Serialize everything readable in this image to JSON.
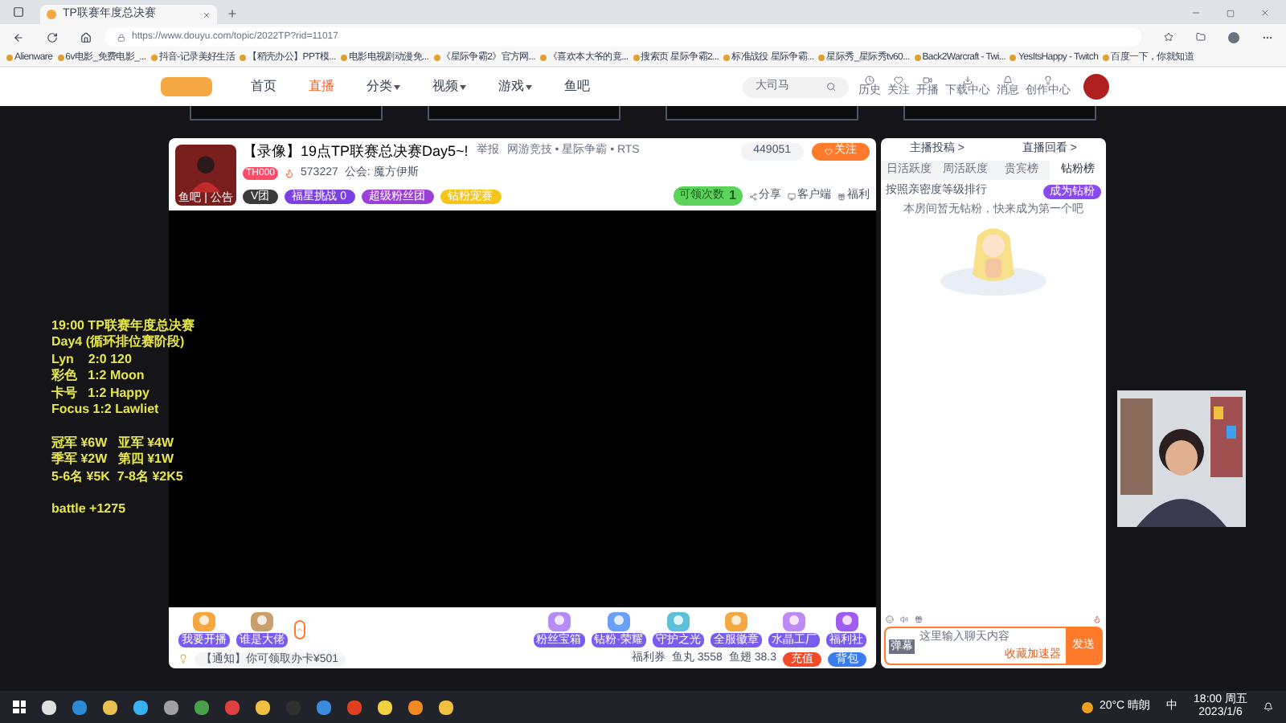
{
  "browser": {
    "tab_title": "TP联赛年度总决赛",
    "url": "https://www.douyu.com/topic/2022TP?rid=11017",
    "bookmarks": [
      "Alienware",
      "6v电影_免费电影_...",
      "抖音-记录美好生活",
      "【稻壳办公】PPT模...",
      "电影电视剧动漫免...",
      "《星际争霸2》官方网...",
      "《喜欢本大爷的竟...",
      "搜索页 星际争霸2...",
      "标准战役 星际争霸...",
      "星际秀_星际秀tv60...",
      "Back2Warcraft - Twi...",
      "YesItsHappy - Twitch",
      "百度一下，你就知道"
    ]
  },
  "site_nav": {
    "items": [
      {
        "label": "首页",
        "selected": false,
        "dropdown": false
      },
      {
        "label": "直播",
        "selected": true,
        "dropdown": false
      },
      {
        "label": "分类",
        "selected": false,
        "dropdown": true
      },
      {
        "label": "视频",
        "selected": false,
        "dropdown": true
      },
      {
        "label": "游戏",
        "selected": false,
        "dropdown": true
      },
      {
        "label": "鱼吧",
        "selected": false,
        "dropdown": false
      }
    ],
    "search": {
      "placeholder": "大司马"
    },
    "actions": [
      "历史",
      "关注",
      "开播",
      "下载中心",
      "消息",
      "创作中心"
    ]
  },
  "stream": {
    "title": "【录像】19点TP联赛总决赛Day5~!",
    "report": "举报",
    "category": "网游竞技 • 星际争霸 • RTS",
    "level": "TH000",
    "hot": "573227",
    "guild": "公会: 魔方伊斯",
    "avatar_caption": "鱼吧 | 公告",
    "badges": [
      {
        "label": "V团",
        "color": "#3a3a3a"
      },
      {
        "label": "福星挑战 0",
        "color": "#7b3fe4"
      },
      {
        "label": "超级粉丝团",
        "color": "#9b3fd6"
      },
      {
        "label": "钻粉宠赛",
        "color": "#f5c518"
      }
    ],
    "followers": "449051",
    "follow_label": "关注",
    "claim": {
      "label": "可领次数",
      "count": "1"
    },
    "actions": [
      "分享",
      "客户端",
      "福利"
    ]
  },
  "overlay_blocks": [
    [
      "19:00 TP联赛年度总决赛",
      "Day4 (循环排位赛阶段)",
      "Lyn    2:0 120",
      "彩色   1:2 Moon",
      "卡号   1:2 Happy",
      "Focus 1:2 Lawliet"
    ],
    [
      "冠军 ¥6W   亚军 ¥4W",
      "季军 ¥2W   第四 ¥1W",
      "5-6名 ¥5K  7-8名 ¥2K5"
    ],
    [
      "battle +1275"
    ]
  ],
  "toolbar": {
    "left_items": [
      "我要开播",
      "谁是大佬"
    ],
    "gifts": [
      "粉丝宝箱",
      "钻粉·荣耀",
      "守护之光",
      "全服徽章",
      "水晶工厂",
      "福利社"
    ],
    "notice": "【通知】你可领取办卡¥501",
    "wallet": [
      "福利券",
      "鱼丸 3558",
      "鱼翅 38.3"
    ],
    "buttons": [
      {
        "label": "充值",
        "color": "#f04a2a"
      },
      {
        "label": "背包",
        "color": "#3a7cf0"
      }
    ]
  },
  "side_panel": {
    "links": [
      "主播投稿 >",
      "直播回看 >"
    ],
    "tabs": [
      {
        "label": "日活跃度",
        "selected": false
      },
      {
        "label": "周活跃度",
        "selected": false
      },
      {
        "label": "贵宾榜",
        "selected": false
      },
      {
        "label": "钻粉榜",
        "selected": true
      }
    ],
    "rank_label": "按照亲密度等级排行",
    "become_fan": "成为钻粉",
    "empty_text": "本房间暂无钻粉，快来成为第一个吧",
    "chat": {
      "mode": "弹幕",
      "placeholder": "这里输入聊天内容",
      "hint": "收藏加速器",
      "send": "发送"
    }
  },
  "taskbar": {
    "weather": "20°C 晴朗",
    "ime": "中",
    "time": "18:00 周五",
    "date": "2023/1/6"
  }
}
